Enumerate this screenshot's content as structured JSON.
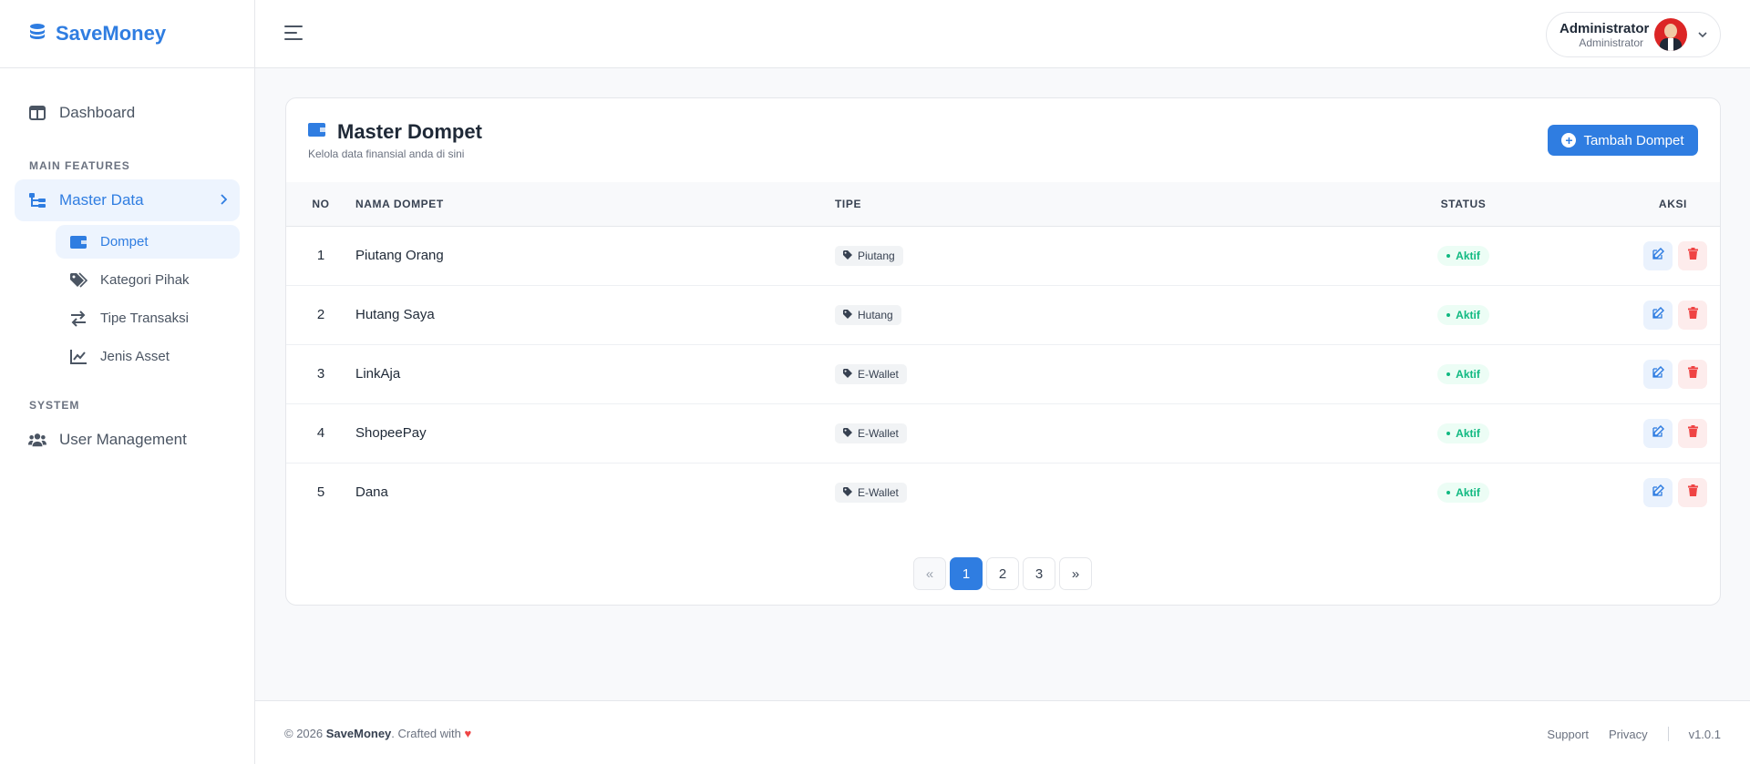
{
  "brand": {
    "name": "SaveMoney",
    "icon": "coins-icon"
  },
  "colors": {
    "primary": "#2f7de1",
    "success": "#10b981",
    "danger": "#ef4444"
  },
  "sidebar": {
    "dashboard_label": "Dashboard",
    "section_main": "MAIN FEATURES",
    "master_data_label": "Master Data",
    "sub_items": [
      {
        "label": "Dompet",
        "icon": "wallet-icon",
        "active": true
      },
      {
        "label": "Kategori Pihak",
        "icon": "tags-icon",
        "active": false
      },
      {
        "label": "Tipe Transaksi",
        "icon": "exchange-icon",
        "active": false
      },
      {
        "label": "Jenis Asset",
        "icon": "chart-line-icon",
        "active": false
      }
    ],
    "section_system": "SYSTEM",
    "user_management_label": "User Management"
  },
  "header": {
    "user_name": "Administrator",
    "user_role": "Administrator"
  },
  "page": {
    "title": "Master Dompet",
    "subtitle": "Kelola data finansial anda di sini",
    "add_button_label": "Tambah Dompet"
  },
  "table": {
    "columns": [
      "NO",
      "NAMA DOMPET",
      "TIPE",
      "STATUS",
      "AKSI"
    ],
    "rows": [
      {
        "no": "1",
        "name": "Piutang Orang",
        "type": "Piutang",
        "status": "Aktif"
      },
      {
        "no": "2",
        "name": "Hutang Saya",
        "type": "Hutang",
        "status": "Aktif"
      },
      {
        "no": "3",
        "name": "LinkAja",
        "type": "E-Wallet",
        "status": "Aktif"
      },
      {
        "no": "4",
        "name": "ShopeePay",
        "type": "E-Wallet",
        "status": "Aktif"
      },
      {
        "no": "5",
        "name": "Dana",
        "type": "E-Wallet",
        "status": "Aktif"
      }
    ]
  },
  "pagination": {
    "prev": "«",
    "pages": [
      "1",
      "2",
      "3"
    ],
    "current": "1",
    "next": "»"
  },
  "footer": {
    "copyright": "© 2026",
    "brand": "SaveMoney",
    "crafted": ". Crafted with",
    "heart": "♥",
    "links": [
      "Support",
      "Privacy"
    ],
    "version": "v1.0.1"
  }
}
